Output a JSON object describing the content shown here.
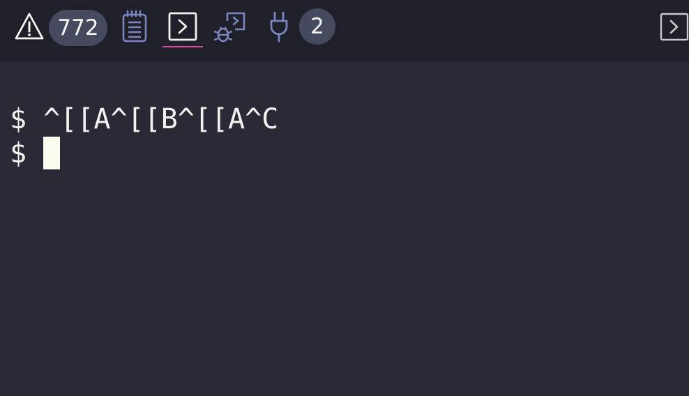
{
  "toolbar": {
    "problems": {
      "icon": "warning-icon",
      "count": "772"
    },
    "output_icon": "notepad-icon",
    "terminal_icon": "terminal-icon",
    "debug_console_icon": "debug-console-icon",
    "ports": {
      "icon": "plug-icon",
      "count": "2"
    },
    "expand_icon": "chevron-right-box-icon",
    "colors": {
      "bar_bg": "#1f2029",
      "badge_bg": "#454a5e",
      "icon_muted": "#7b86c0",
      "active_underline": "#d14fa0"
    }
  },
  "terminal": {
    "lines": [
      {
        "prompt": "$",
        "text": "^[[A^[[B^[[A^C"
      },
      {
        "prompt": "$",
        "text": ""
      }
    ],
    "colors": {
      "bg": "#292a36",
      "fg": "#f2f2ee",
      "cursor": "#fbfbf0"
    }
  }
}
